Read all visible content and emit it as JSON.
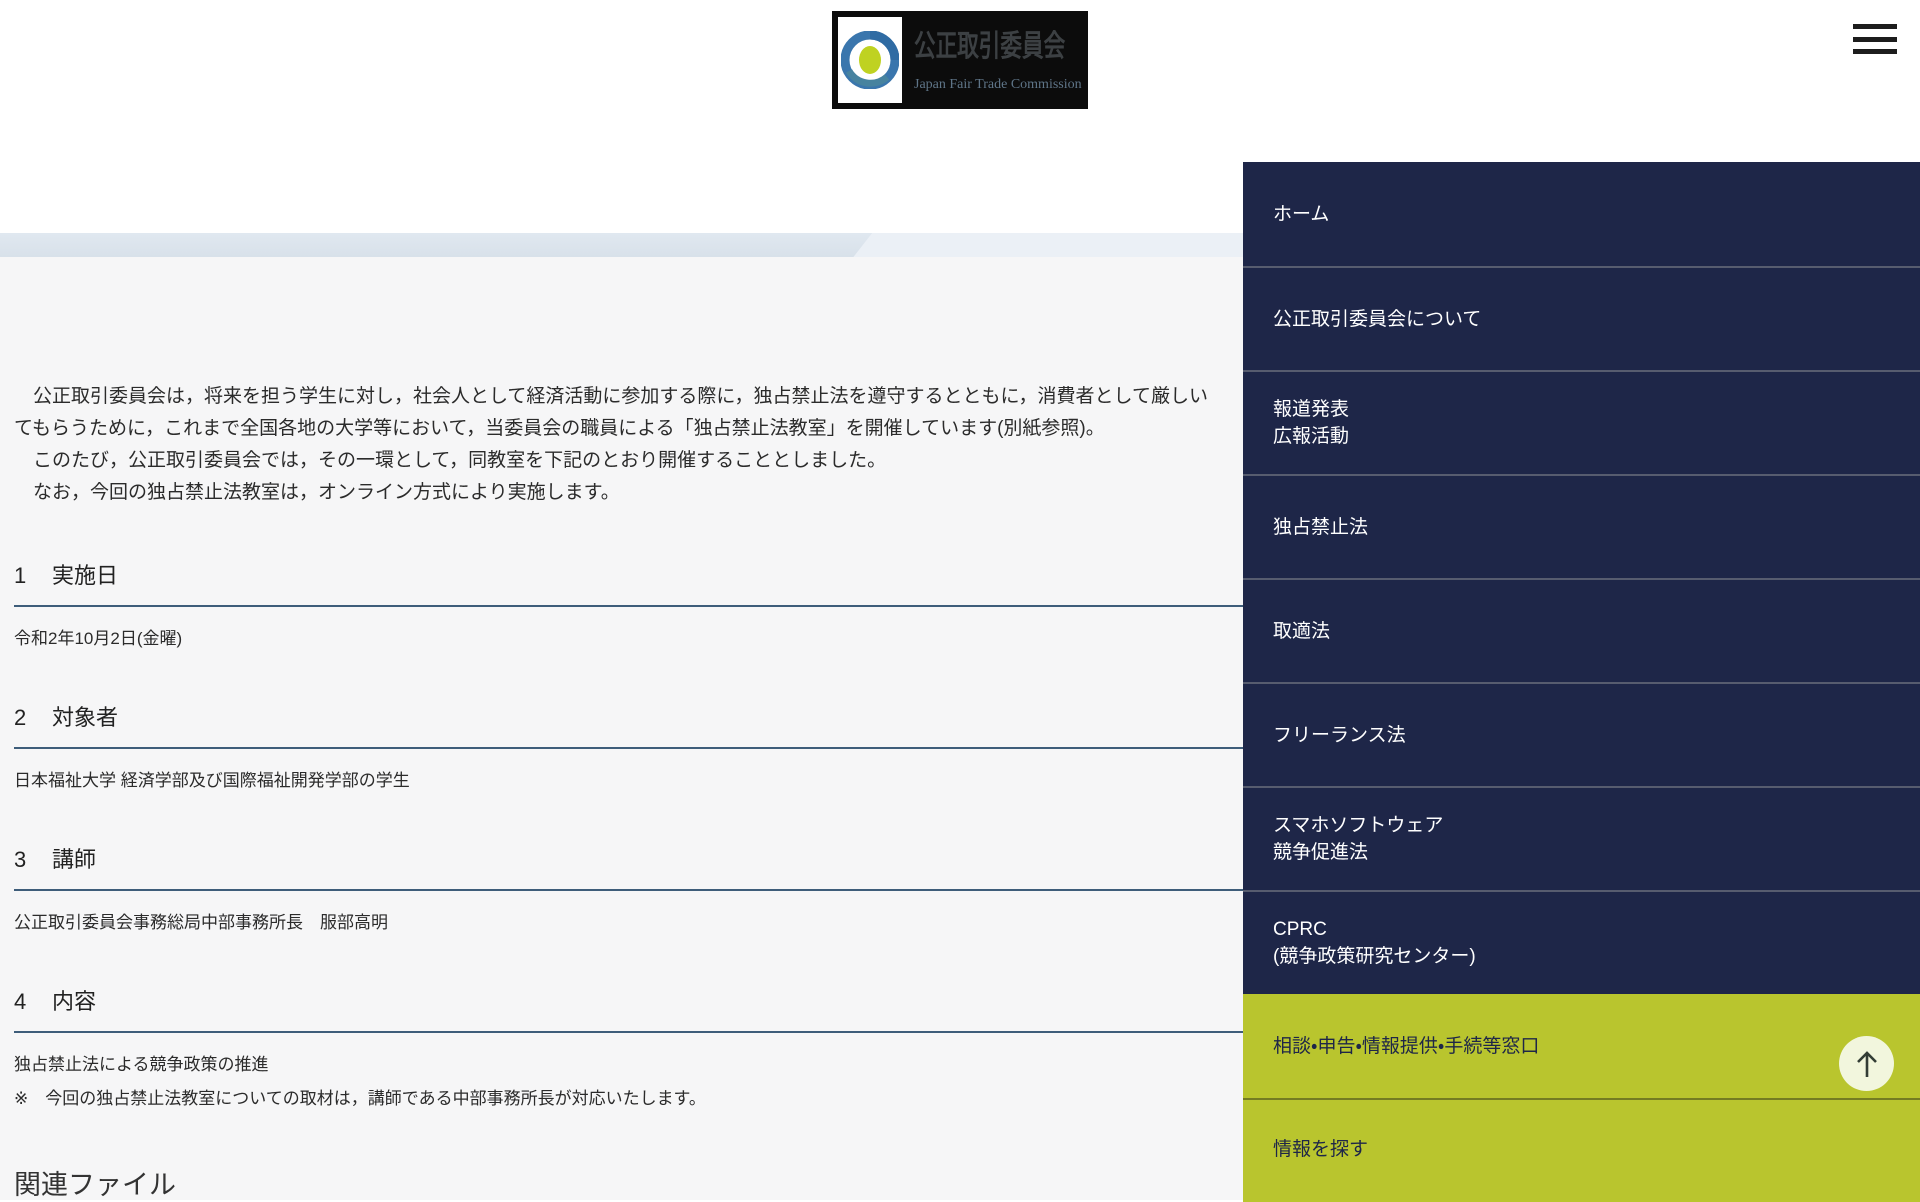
{
  "colors": {
    "nav_bg": "#1e2648",
    "nav_divider": "#575c6f",
    "nav_accent_bg": "#b9c52e",
    "nav_accent_text": "#1e2648",
    "band_blue": "#dce4ed",
    "content_bg": "#f6f6f7",
    "heading_rule": "#3e5d7a",
    "logo_bg": "#0c0c0c",
    "emblem_ring_blue": "#3a76ad",
    "emblem_center_green": "#bfd221"
  },
  "header": {
    "logo_jp": "公正取引委員会",
    "logo_en": "Japan Fair Trade Commission"
  },
  "nav": {
    "items": [
      {
        "label": "ホーム",
        "accent": false
      },
      {
        "label": "公正取引委員会について",
        "accent": false
      },
      {
        "label": "報道発表\n広報活動",
        "accent": false
      },
      {
        "label": "独占禁止法",
        "accent": false
      },
      {
        "label": "取適法",
        "accent": false
      },
      {
        "label": "フリーランス法",
        "accent": false
      },
      {
        "label": "スマホソフトウェア\n競争促進法",
        "accent": false
      },
      {
        "label": "CPRC\n(競争政策研究センター)",
        "accent": false
      },
      {
        "label": "相談・申告・情報提供・手続等窓口",
        "accent": true
      },
      {
        "label": "情報を探す",
        "accent": true
      }
    ]
  },
  "content": {
    "intro_lines": [
      "　公正取引委員会は，将来を担う学生に対し，社会人として経済活動に参加する際に，独占禁止法を遵守するとともに，消費者として厳しい",
      "てもらうために，これまで全国各地の大学等において，当委員会の職員による「独占禁止法教室」を開催しています(別紙参照)。",
      "　このたび，公正取引委員会では，その一環として，同教室を下記のとおり開催することとしました。",
      "　なお，今回の独占禁止法教室は，オンライン方式により実施します。"
    ],
    "sections": [
      {
        "no": "1",
        "title": "実施日",
        "body1": "令和2年10月2日(金曜)",
        "body2": ""
      },
      {
        "no": "2",
        "title": "対象者",
        "body1": "日本福祉大学 経済学部及び国際福祉開発学部の学生",
        "body2": ""
      },
      {
        "no": "3",
        "title": "講師",
        "body1": "公正取引委員会事務総局中部事務所長　服部高明",
        "body2": ""
      },
      {
        "no": "4",
        "title": "内容",
        "body1": "独占禁止法による競争政策の推進",
        "body2": "※　今回の独占禁止法教室についての取材は，講師である中部事務所長が対応いたします。"
      }
    ],
    "related_files_heading": "関連ファイル"
  }
}
